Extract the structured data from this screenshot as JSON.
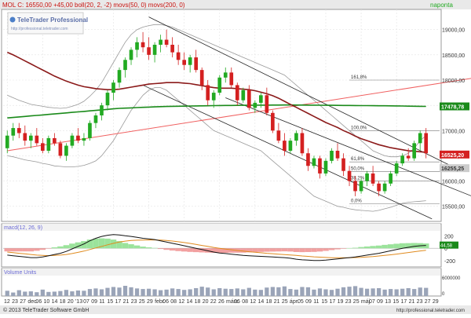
{
  "header": {
    "ticker_label": "MOL C: 16550,00 +45,00 boll(20, 2, -2) movs(50, 0) movs(200, 0)",
    "period_label": "napontа"
  },
  "watermark": {
    "brand": "TeleTrader Professional",
    "url": "http://professional.teletrader.com"
  },
  "footer": {
    "copyright": "© 2013 TeleTrader Software GmbH",
    "url": "http://professional.teletrader.com"
  },
  "colors": {
    "up_candle": "#22aa22",
    "down_candle": "#d42020",
    "ma50": "#8b1a1a",
    "ma200": "#1a8a1a",
    "bollinger": "#999999",
    "trend_red": "#f06060",
    "channel": "#222222",
    "macd": "#111111",
    "signal": "#e08a1e",
    "header_bg": "#e9e9e9",
    "panel_label": "#6b6bd6"
  },
  "chart_data": [
    {
      "type": "candlestick",
      "title": "MOL C",
      "period": "napontа",
      "ylim": [
        15200,
        19400
      ],
      "y_ticks": [
        15500,
        16000,
        16500,
        17000,
        17500,
        18000,
        18500,
        19000
      ],
      "y_tick_labels": [
        "15500,00",
        "16000,00",
        "16500,00",
        "17000,00",
        "17500,00",
        "18000,00",
        "18500,00",
        "19000,00"
      ],
      "x_tick_labels": [
        "12",
        "23",
        "27",
        "dec.",
        "06",
        "10",
        "14",
        "18",
        "20",
        "'13",
        "07",
        "09",
        "11",
        "15",
        "17",
        "21",
        "23",
        "25",
        "29",
        "febr.",
        "06",
        "08",
        "12",
        "14",
        "18",
        "20",
        "22",
        "26",
        "márc.",
        "06",
        "08",
        "12",
        "14",
        "18",
        "21",
        "25",
        "ápr.",
        "05",
        "09",
        "11",
        "15",
        "17",
        "19",
        "23",
        "25",
        "máj.",
        "07",
        "09",
        "13",
        "15",
        "17",
        "21",
        "23",
        "27",
        "29"
      ],
      "last_close": 16550,
      "candles": [
        [
          16650,
          17000,
          16550,
          16900
        ],
        [
          16900,
          17150,
          16800,
          17050
        ],
        [
          17050,
          17150,
          16850,
          16950
        ],
        [
          16950,
          17100,
          16700,
          16800
        ],
        [
          16800,
          16950,
          16650,
          16900
        ],
        [
          16900,
          17050,
          16700,
          16750
        ],
        [
          16750,
          16850,
          16550,
          16600
        ],
        [
          16600,
          16900,
          16550,
          16850
        ],
        [
          16850,
          16950,
          16700,
          16750
        ],
        [
          16750,
          16800,
          16450,
          16500
        ],
        [
          16500,
          16750,
          16400,
          16700
        ],
        [
          16700,
          16950,
          16650,
          16900
        ],
        [
          16900,
          17050,
          16750,
          16800
        ],
        [
          16800,
          16950,
          16700,
          16850
        ],
        [
          16850,
          17200,
          16800,
          17150
        ],
        [
          17150,
          17350,
          17050,
          17300
        ],
        [
          17300,
          17550,
          17200,
          17500
        ],
        [
          17500,
          17800,
          17400,
          17750
        ],
        [
          17750,
          18000,
          17600,
          17950
        ],
        [
          17950,
          18250,
          17850,
          18200
        ],
        [
          18200,
          18450,
          18050,
          18400
        ],
        [
          18400,
          18650,
          18300,
          18600
        ],
        [
          18600,
          18850,
          18450,
          18750
        ],
        [
          18750,
          18950,
          18550,
          18650
        ],
        [
          18650,
          18850,
          18400,
          18500
        ],
        [
          18500,
          18750,
          18350,
          18700
        ],
        [
          18700,
          18900,
          18550,
          18800
        ],
        [
          18800,
          19000,
          18650,
          18700
        ],
        [
          18700,
          18850,
          18450,
          18550
        ],
        [
          18550,
          18700,
          18300,
          18400
        ],
        [
          18400,
          18550,
          18200,
          18300
        ],
        [
          18300,
          18500,
          18150,
          18450
        ],
        [
          18450,
          18600,
          18150,
          18200
        ],
        [
          18200,
          18250,
          17800,
          17900
        ],
        [
          17900,
          18000,
          17500,
          17600
        ],
        [
          17600,
          17800,
          17450,
          17750
        ],
        [
          17750,
          18100,
          17700,
          18050
        ],
        [
          18050,
          18250,
          17950,
          18150
        ],
        [
          18150,
          18250,
          17850,
          17900
        ],
        [
          17900,
          17950,
          17500,
          17600
        ],
        [
          17600,
          17850,
          17550,
          17800
        ],
        [
          17800,
          17900,
          17400,
          17450
        ],
        [
          17450,
          17600,
          17350,
          17550
        ],
        [
          17550,
          17750,
          17450,
          17700
        ],
        [
          17700,
          17850,
          17300,
          17350
        ],
        [
          17350,
          17400,
          16950,
          17000
        ],
        [
          17000,
          17150,
          16750,
          16800
        ],
        [
          16800,
          16950,
          16500,
          16600
        ],
        [
          16600,
          16850,
          16550,
          16800
        ],
        [
          16800,
          17000,
          16700,
          16950
        ],
        [
          16950,
          17050,
          16500,
          16550
        ],
        [
          16550,
          16650,
          16200,
          16300
        ],
        [
          16300,
          16500,
          16250,
          16450
        ],
        [
          16450,
          16500,
          16050,
          16150
        ],
        [
          16150,
          16450,
          16100,
          16400
        ],
        [
          16400,
          16650,
          16350,
          16600
        ],
        [
          16600,
          16750,
          16400,
          16450
        ],
        [
          16450,
          16550,
          16100,
          16200
        ],
        [
          16200,
          16300,
          15900,
          16000
        ],
        [
          16000,
          16100,
          15700,
          15800
        ],
        [
          15800,
          16050,
          15750,
          16000
        ],
        [
          16000,
          16200,
          15900,
          16150
        ],
        [
          16150,
          16300,
          15900,
          15950
        ],
        [
          15950,
          16000,
          15700,
          15800
        ],
        [
          15800,
          16000,
          15750,
          15950
        ],
        [
          15950,
          16200,
          15900,
          16150
        ],
        [
          16150,
          16400,
          16100,
          16350
        ],
        [
          16350,
          16550,
          16300,
          16500
        ],
        [
          16500,
          16650,
          16400,
          16450
        ],
        [
          16450,
          16800,
          16400,
          16750
        ],
        [
          16750,
          17000,
          16600,
          16950
        ],
        [
          16950,
          17050,
          16450,
          16550
        ]
      ],
      "overlays": {
        "ma50": [
          18550,
          18500,
          18440,
          18380,
          18320,
          18260,
          18200,
          18140,
          18080,
          18030,
          17980,
          17940,
          17900,
          17870,
          17850,
          17830,
          17820,
          17810,
          17810,
          17820,
          17840,
          17860,
          17880,
          17900,
          17920,
          17930,
          17940,
          17950,
          17950,
          17950,
          17940,
          17930,
          17910,
          17890,
          17870,
          17850,
          17840,
          17840,
          17840,
          17830,
          17820,
          17810,
          17790,
          17760,
          17730,
          17690,
          17640,
          17580,
          17520,
          17460,
          17400,
          17340,
          17280,
          17220,
          17160,
          17110,
          17060,
          17000,
          16950,
          16890,
          16840,
          16800,
          16760,
          16720,
          16690,
          16660,
          16640,
          16620,
          16600,
          16590,
          16580,
          16570
        ],
        "ma200": [
          17250,
          17260,
          17270,
          17280,
          17290,
          17300,
          17310,
          17320,
          17330,
          17340,
          17350,
          17360,
          17370,
          17380,
          17390,
          17400,
          17410,
          17420,
          17430,
          17440,
          17445,
          17450,
          17455,
          17460,
          17465,
          17470,
          17475,
          17478,
          17480,
          17482,
          17484,
          17486,
          17488,
          17490,
          17492,
          17494,
          17496,
          17497,
          17498,
          17499,
          17500,
          17501,
          17502,
          17503,
          17504,
          17505,
          17506,
          17507,
          17507,
          17506,
          17505,
          17504,
          17503,
          17502,
          17501,
          17500,
          17499,
          17498,
          17497,
          17496,
          17495,
          17494,
          17493,
          17492,
          17491,
          17490,
          17488,
          17486,
          17484,
          17482,
          17480,
          17478.78
        ],
        "boll_upper": [
          17700,
          17650,
          17600,
          17560,
          17520,
          17500,
          17480,
          17460,
          17450,
          17440,
          17450,
          17480,
          17520,
          17580,
          17680,
          17800,
          17950,
          18150,
          18350,
          18550,
          18750,
          18900,
          19000,
          19050,
          19080,
          19100,
          19100,
          19080,
          19050,
          19000,
          18950,
          18900,
          18850,
          18800,
          18750,
          18700,
          18650,
          18600,
          18550,
          18500,
          18450,
          18400,
          18350,
          18300,
          18250,
          18200,
          18150,
          18100,
          18000,
          17900,
          17800,
          17700,
          17600,
          17500,
          17400,
          17300,
          17200,
          17100,
          17000,
          16900,
          16800,
          16700,
          16600,
          16550,
          16500,
          16480,
          16480,
          16500,
          16550,
          16650,
          16800,
          16900
        ],
        "boll_lower": [
          16500,
          16480,
          16450,
          16420,
          16400,
          16380,
          16350,
          16330,
          16300,
          16290,
          16280,
          16280,
          16290,
          16310,
          16350,
          16400,
          16500,
          16650,
          16800,
          17000,
          17200,
          17400,
          17550,
          17700,
          17800,
          17850,
          17850,
          17800,
          17700,
          17600,
          17500,
          17400,
          17300,
          17200,
          17100,
          17000,
          16950,
          16900,
          16850,
          16800,
          16750,
          16700,
          16650,
          16600,
          16500,
          16400,
          16300,
          16200,
          16100,
          16000,
          15900,
          15800,
          15700,
          15650,
          15600,
          15550,
          15500,
          15480,
          15450,
          15430,
          15420,
          15410,
          15400,
          15420,
          15450,
          15480,
          15520,
          15560,
          15580,
          15590,
          15600,
          15610
        ]
      },
      "trendlines": [
        {
          "name": "red-trend",
          "from": [
            0,
            16600
          ],
          "to": [
            85,
            18150
          ]
        },
        {
          "name": "channel-upper",
          "from": [
            24,
            19250
          ],
          "to": [
            77,
            16200
          ]
        },
        {
          "name": "channel-lower",
          "from": [
            23,
            17900
          ],
          "to": [
            72,
            15250
          ]
        },
        {
          "name": "channel-outer",
          "from": [
            37,
            17650
          ],
          "to": [
            82,
            15550
          ]
        }
      ],
      "fibonacci": [
        {
          "label": "161,8%",
          "value": 18000
        },
        {
          "label": "100,0%",
          "value": 17000
        },
        {
          "label": "61,8%",
          "value": 16380
        },
        {
          "label": "50,0%",
          "value": 16190
        },
        {
          "label": "38,2%",
          "value": 16000
        },
        {
          "label": "0,0%",
          "value": 15550
        }
      ],
      "price_tags": [
        {
          "label": "17478,78",
          "value": 17478.78,
          "color": "#1a8a1a"
        },
        {
          "label": "16525,20",
          "value": 16525.2,
          "color": "#d42020"
        },
        {
          "label": "16255,25",
          "value": 16255.25,
          "color": "#cccccc"
        }
      ]
    },
    {
      "type": "line",
      "title": "macd(12, 26, 9)",
      "ylim": [
        -300,
        280
      ],
      "y_tick_labels": [
        "200",
        "0",
        "-200"
      ],
      "last_value_label": "44,58",
      "series": [
        {
          "name": "macd",
          "values": [
            -110,
            -120,
            -130,
            -140,
            -150,
            -150,
            -140,
            -120,
            -100,
            -80,
            -50,
            -10,
            30,
            70,
            120,
            160,
            190,
            210,
            220,
            215,
            200,
            190,
            175,
            160,
            150,
            140,
            120,
            100,
            80,
            60,
            40,
            20,
            0,
            -20,
            -40,
            -60,
            -75,
            -85,
            -95,
            -105,
            -115,
            -120,
            -125,
            -130,
            -135,
            -140,
            -145,
            -150,
            -160,
            -175,
            -185,
            -190,
            -195,
            -195,
            -190,
            -180,
            -170,
            -160,
            -150,
            -140,
            -125,
            -110,
            -95,
            -80,
            -60,
            -40,
            -20,
            0,
            15,
            30,
            40,
            45
          ]
        },
        {
          "name": "signal",
          "values": [
            -60,
            -70,
            -80,
            -90,
            -100,
            -110,
            -115,
            -118,
            -115,
            -110,
            -100,
            -85,
            -65,
            -45,
            -20,
            5,
            30,
            55,
            80,
            100,
            115,
            125,
            130,
            133,
            135,
            134,
            131,
            125,
            116,
            105,
            92,
            78,
            62,
            46,
            30,
            14,
            0,
            -12,
            -24,
            -35,
            -45,
            -55,
            -64,
            -72,
            -80,
            -87,
            -94,
            -101,
            -108,
            -115,
            -123,
            -130,
            -137,
            -143,
            -148,
            -151,
            -153,
            -153,
            -152,
            -149,
            -145,
            -139,
            -132,
            -124,
            -115,
            -104,
            -93,
            -81,
            -68,
            -55,
            -43,
            -32
          ]
        }
      ]
    },
    {
      "type": "bar",
      "title": "Volume Units",
      "ylim": [
        0,
        700000
      ],
      "y_tick_labels": [
        "6000000",
        "0"
      ],
      "values": [
        180000,
        120000,
        200000,
        150000,
        160000,
        130000,
        220000,
        140000,
        150000,
        170000,
        210000,
        160000,
        190000,
        180000,
        240000,
        260000,
        230000,
        280000,
        310000,
        290000,
        350000,
        300000,
        260000,
        240000,
        250000,
        230000,
        200000,
        220000,
        260000,
        240000,
        210000,
        230000,
        270000,
        320000,
        290000,
        230000,
        270000,
        250000,
        240000,
        260000,
        230000,
        280000,
        220000,
        210000,
        290000,
        310000,
        300000,
        330000,
        240000,
        220000,
        310000,
        300000,
        220000,
        260000,
        230000,
        210000,
        250000,
        300000,
        320000,
        340000,
        280000,
        250000,
        260000,
        270000,
        220000,
        240000,
        230000,
        250000,
        270000,
        240000,
        290000,
        280000
      ]
    }
  ]
}
